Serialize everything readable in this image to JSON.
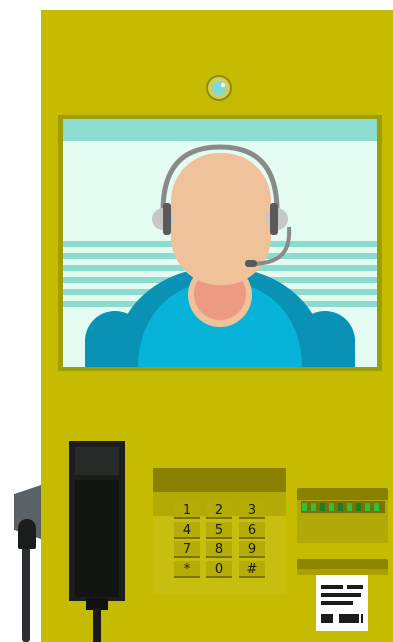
{
  "colors": {
    "kiosk": "#c5bb00",
    "screen_bg": "#e3fbf0",
    "screen_stripe": "#8cdcd0",
    "skin": "#f0c29a",
    "shirt": "#07b3d8",
    "shirt_shadow": "#0a92b6",
    "neck_shadow": "#ec9a83",
    "camera_ring": "#d4cc5c",
    "camera_lens": "#7edcd8",
    "led_bright": "#2ec23c",
    "led_dark": "#1d7e28"
  },
  "keypad": {
    "keys": [
      "1",
      "2",
      "3",
      "4",
      "5",
      "6",
      "7",
      "8",
      "9",
      "*",
      "0",
      "#"
    ]
  },
  "icons": {
    "camera": "camera-icon",
    "agent": "support-agent-icon",
    "handset": "phone-handset-icon",
    "card_reader": "card-reader-icon",
    "receipt": "receipt-icon"
  }
}
